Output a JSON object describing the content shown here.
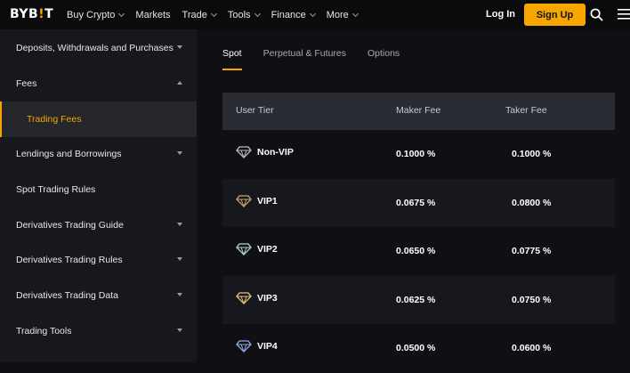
{
  "header": {
    "logo": {
      "left": "BYB",
      "bar": "!",
      "right": "T"
    },
    "nav": [
      {
        "label": "Buy Crypto",
        "dropdown": true
      },
      {
        "label": "Markets",
        "dropdown": false
      },
      {
        "label": "Trade",
        "dropdown": true
      },
      {
        "label": "Tools",
        "dropdown": true
      },
      {
        "label": "Finance",
        "dropdown": true
      },
      {
        "label": "More",
        "dropdown": true
      }
    ],
    "login_label": "Log In",
    "signup_label": "Sign Up",
    "icons": [
      "search-icon",
      "menu-icon"
    ],
    "accent_color": "#f7a600"
  },
  "sidebar": {
    "items": [
      {
        "label": "Deposits, Withdrawals and Purchases",
        "caret": "down"
      },
      {
        "label": "Fees",
        "caret": "up"
      },
      {
        "label": "Trading Fees",
        "caret": "none",
        "active": true
      },
      {
        "label": "Lendings and Borrowings",
        "caret": "down"
      },
      {
        "label": "Spot Trading Rules",
        "caret": "none"
      },
      {
        "label": "Derivatives Trading Guide",
        "caret": "down"
      },
      {
        "label": "Derivatives Trading Rules",
        "caret": "down"
      },
      {
        "label": "Derivatives Trading Data",
        "caret": "down"
      },
      {
        "label": "Trading Tools",
        "caret": "down"
      }
    ]
  },
  "main": {
    "tabs": [
      {
        "label": "Spot",
        "active": true
      },
      {
        "label": "Perpetual & Futures",
        "active": false
      },
      {
        "label": "Options",
        "active": false
      }
    ],
    "table": {
      "headers": [
        "User Tier",
        "Maker Fee",
        "Taker Fee"
      ],
      "rows": [
        {
          "tier": "Non-VIP",
          "maker": "0.1000 %",
          "taker": "0.1000 %",
          "gem_color": "#b8bcc6"
        },
        {
          "tier": "VIP1",
          "maker": "0.0675 %",
          "taker": "0.0800 %",
          "gem_color": "#c8a36a"
        },
        {
          "tier": "VIP2",
          "maker": "0.0650 %",
          "taker": "0.0775 %",
          "gem_color": "#a9d8cf"
        },
        {
          "tier": "VIP3",
          "maker": "0.0625 %",
          "taker": "0.0750 %",
          "gem_color": "#e8c07a"
        },
        {
          "tier": "VIP4",
          "maker": "0.0500 %",
          "taker": "0.0600 %",
          "gem_color": "#8fa8e8"
        }
      ]
    }
  }
}
